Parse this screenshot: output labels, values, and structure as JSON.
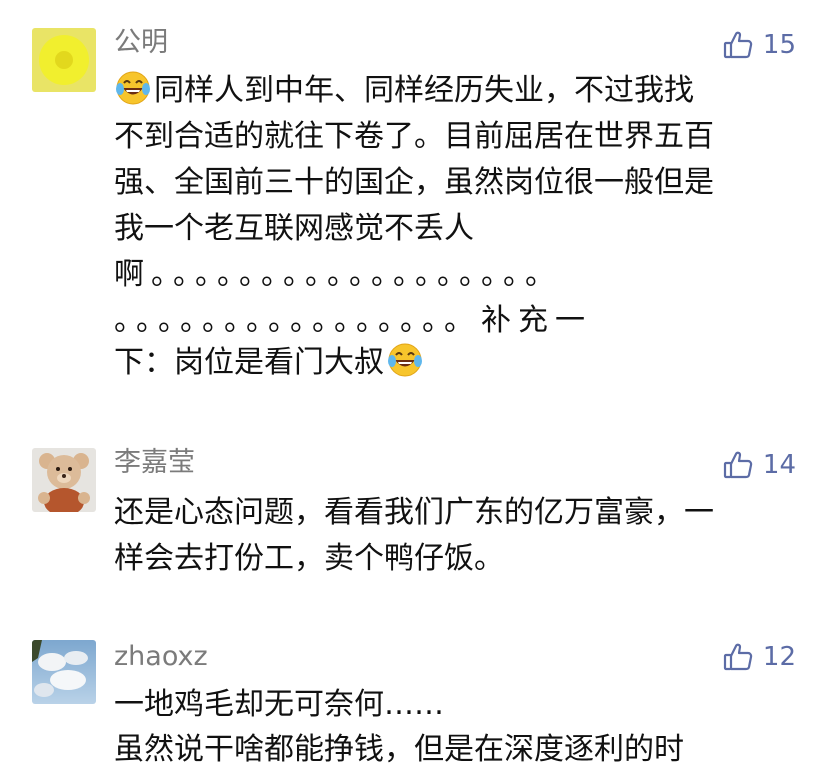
{
  "comments": [
    {
      "username": "公明",
      "avatar_icon": "yellow-circle-avatar",
      "like_icon": "thumbs-up-icon",
      "likes": "15",
      "emoji_icon": "laughing-tears-emoji",
      "lines": [
        "同样人到中年、同样经历失业，不过我找",
        "不到合适的就往下卷了。目前屈居在世界五百",
        "强、全国前三十的国企，虽然岗位很一般但是",
        "我一个老互联网感觉不丢人",
        "啊。。。。。。。。。。。。。。。。。。",
        "。。。。。。。。。。。。。。。。补充一",
        "下：岗位是看门大叔"
      ]
    },
    {
      "username": "李嘉莹",
      "avatar_icon": "teddy-bear-avatar",
      "like_icon": "thumbs-up-icon",
      "likes": "14",
      "lines": [
        "还是心态问题，看看我们广东的亿万富豪，一",
        "样会去打份工，卖个鸭仔饭。"
      ]
    },
    {
      "username": "zhaoxz",
      "avatar_icon": "sky-clouds-avatar",
      "like_icon": "thumbs-up-icon",
      "likes": "12",
      "lines": [
        "一地鸡毛却无可奈何……",
        "虽然说干啥都能挣钱，但是在深度逐利的时"
      ]
    }
  ],
  "colors": {
    "username": "#7b7b7b",
    "like": "#5c6ca6",
    "text": "#111111",
    "background": "#ffffff"
  }
}
